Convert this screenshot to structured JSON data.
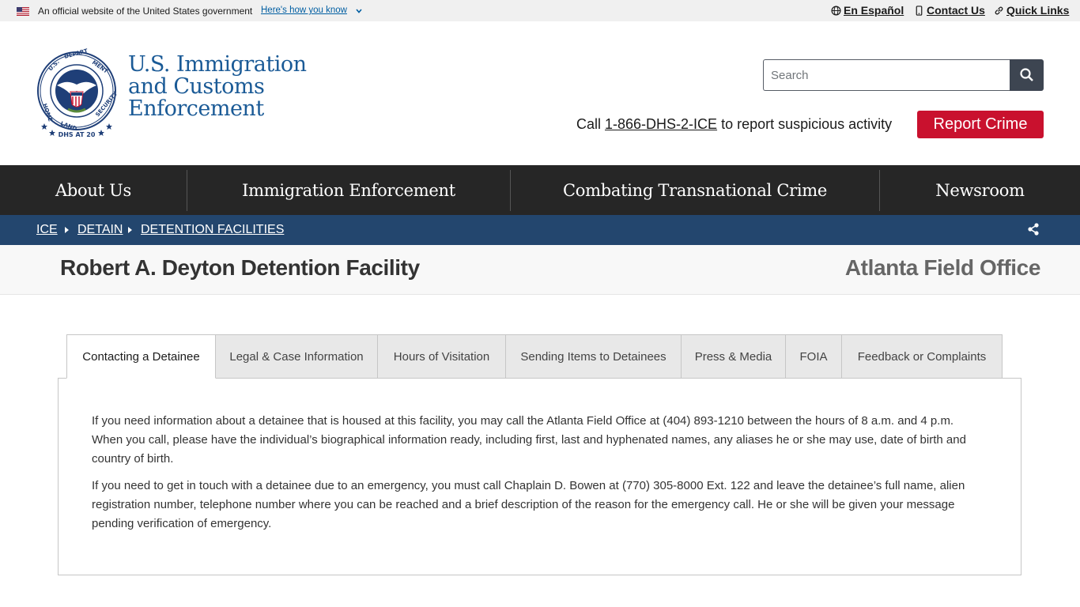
{
  "gov_banner": {
    "official_text": "An official website of the United States government",
    "how_link": "Here's how you know",
    "links": [
      "En Español",
      "Contact Us",
      "Quick Links"
    ]
  },
  "header": {
    "agency_name": [
      "U.S. Immigration",
      "and Customs",
      "Enforcement"
    ],
    "search_placeholder": "Search",
    "call_prefix": "Call ",
    "call_number": "1-866-DHS-2-ICE",
    "call_suffix": " to report suspicious activity",
    "report_button": "Report Crime",
    "seal_text": "U.S. DEPARTMENT OF HOMELAND SECURITY · DHS AT 20"
  },
  "nav": {
    "items": [
      "About Us",
      "Immigration Enforcement",
      "Combating Transnational Crime",
      "Newsroom"
    ]
  },
  "breadcrumb": {
    "items": [
      "ICE",
      "DETAIN",
      "DETENTION FACILITIES"
    ]
  },
  "page": {
    "title": "Robert A. Deyton Detention Facility",
    "field_office": "Atlanta Field Office"
  },
  "tabs": {
    "items": [
      "Contacting a Detainee",
      "Legal & Case Information",
      "Hours of Visitation",
      "Sending Items to Detainees",
      "Press & Media",
      "FOIA",
      "Feedback or Complaints"
    ],
    "active": "Contacting a Detainee"
  },
  "content": {
    "para1": "If you need information about a detainee that is housed at this facility, you may call the Atlanta Field Office at (404) 893-1210 between the hours of 8 a.m. and 4 p.m. When you call, please have the individual’s biographical information ready, including first, last and hyphenated names, any aliases he or she may use, date of birth and country of birth.",
    "para2": "If you need to get in touch with a detainee due to an emergency, you must call Chaplain D. Bowen at (770) 305-8000 Ext. 122 and leave the detainee’s full name, alien registration number, telephone number where you can be reached and a brief description of the reason for the emergency call. He or she will be given your message pending verification of emergency."
  },
  "colors": {
    "agency_blue": "#1a5a96",
    "nav_bg": "#262626",
    "breadcrumb_bg": "#23466e",
    "report_red": "#c9112e"
  }
}
